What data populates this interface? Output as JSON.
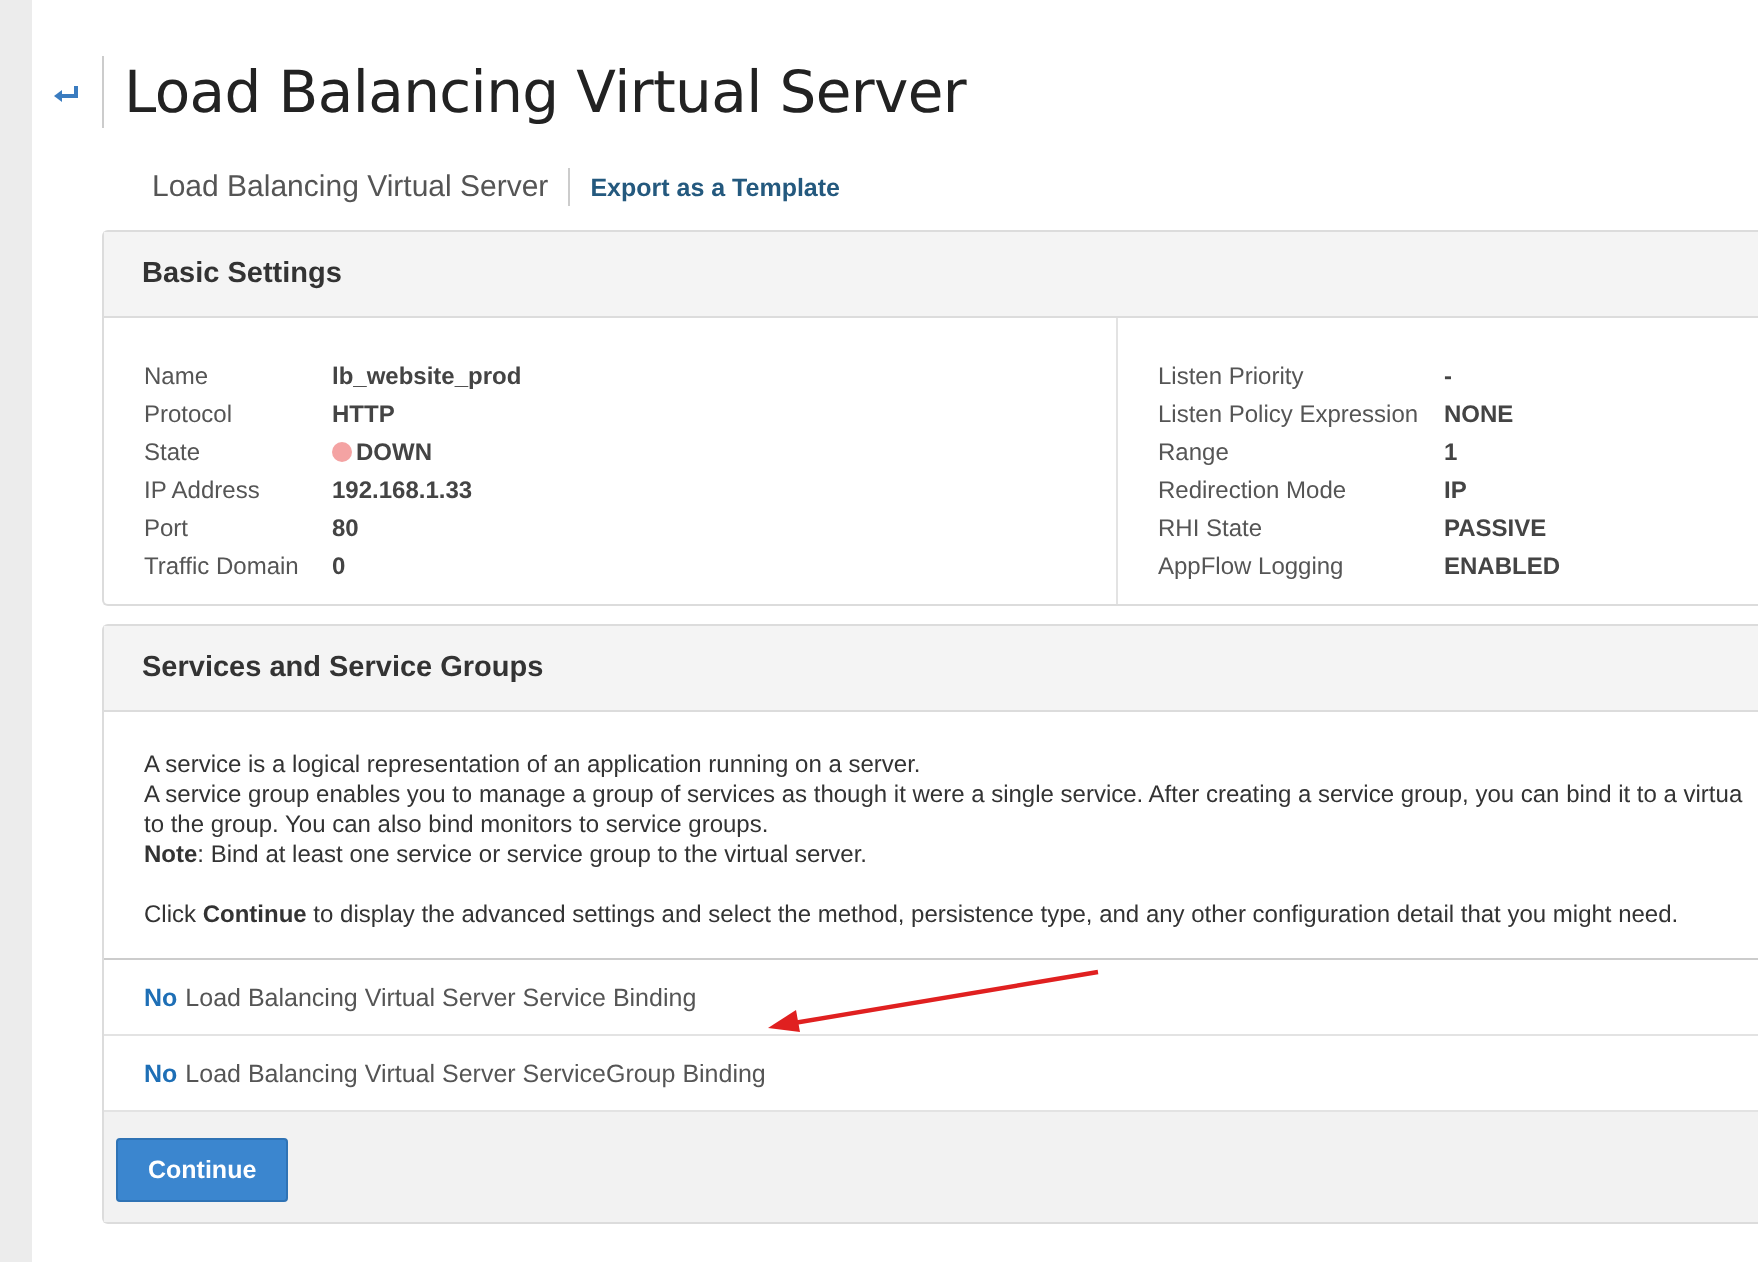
{
  "page": {
    "title": "Load Balancing Virtual Server",
    "breadcrumb": "Load Balancing Virtual Server",
    "export_link": "Export as a Template"
  },
  "basic_settings": {
    "title": "Basic Settings",
    "left": [
      {
        "label": "Name",
        "value": "lb_website_prod",
        "kind": "text"
      },
      {
        "label": "Protocol",
        "value": "HTTP",
        "kind": "text"
      },
      {
        "label": "State",
        "value": "DOWN",
        "kind": "status",
        "color": "#f4a3a3"
      },
      {
        "label": "IP Address",
        "value": "192.168.1.33",
        "kind": "text"
      },
      {
        "label": "Port",
        "value": "80",
        "kind": "text"
      },
      {
        "label": "Traffic Domain",
        "value": "0",
        "kind": "text"
      }
    ],
    "right": [
      {
        "label": "Listen Priority",
        "value": "-",
        "kind": "text"
      },
      {
        "label": "Listen Policy Expression",
        "value": "NONE",
        "kind": "text"
      },
      {
        "label": "Range",
        "value": "1",
        "kind": "text"
      },
      {
        "label": "Redirection Mode",
        "value": "IP",
        "kind": "text"
      },
      {
        "label": "RHI State",
        "value": "PASSIVE",
        "kind": "text"
      },
      {
        "label": "AppFlow Logging",
        "value": "ENABLED",
        "kind": "text"
      }
    ]
  },
  "services": {
    "title": "Services and Service Groups",
    "description_lines": [
      "A service is a logical representation of an application running on a server.",
      "A service group enables you to manage a group of services as though it were a single service. After creating a service group, you can bind it to a virtua",
      "to the group. You can also bind monitors to service groups.",
      "**Note**: Bind at least one service or service group to the virtual server."
    ],
    "instruction": "Click **Continue** to display the advanced settings and select the method, persistence type, and any other configuration detail that you might need.",
    "bindings": [
      {
        "count": "No",
        "label": "Load Balancing Virtual Server Service Binding"
      },
      {
        "count": "No",
        "label": "Load Balancing Virtual Server ServiceGroup Binding"
      }
    ],
    "continue_button": "Continue"
  }
}
